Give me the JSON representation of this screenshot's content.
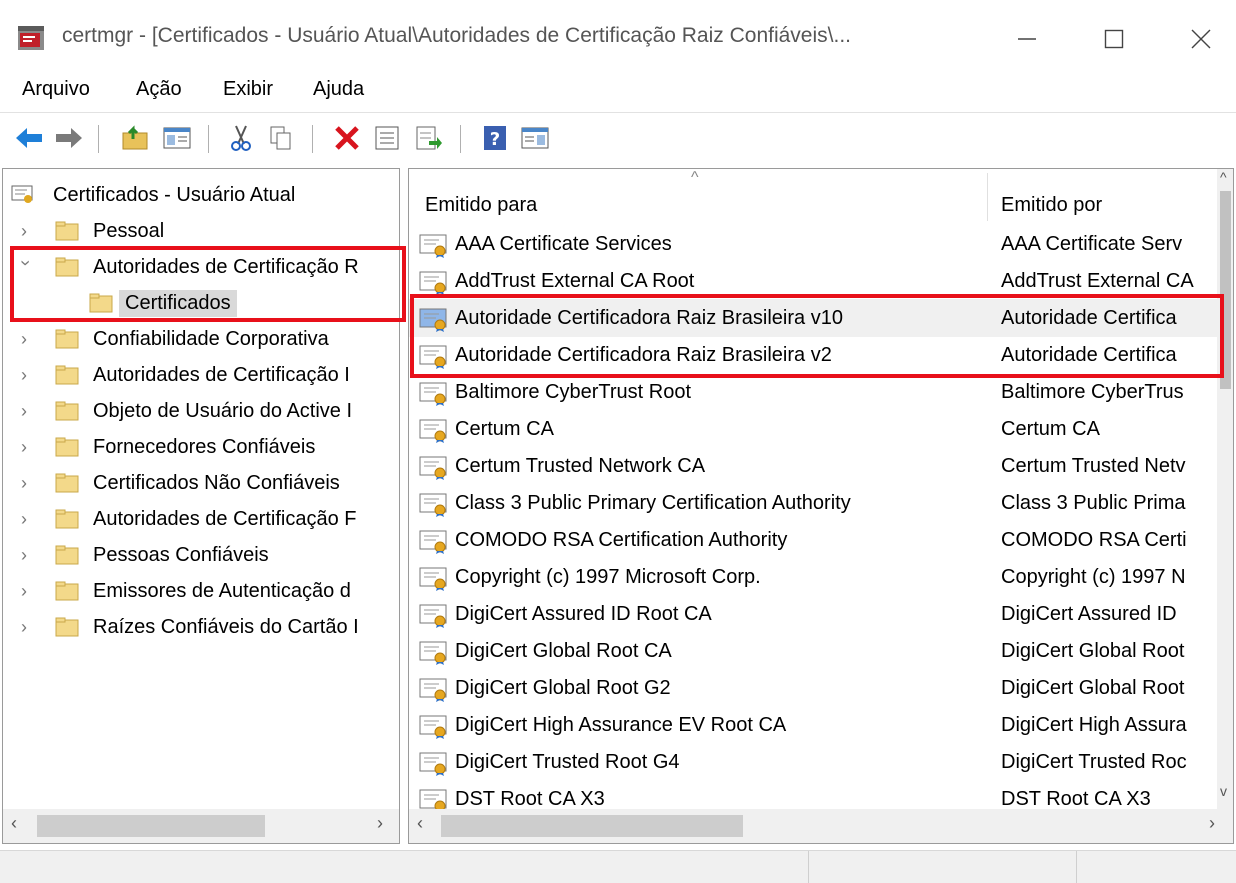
{
  "window": {
    "title": "certmgr - [Certificados - Usuário Atual\\Autoridades de Certificação Raiz Confiáveis\\..."
  },
  "menu": [
    "Arquivo",
    "Ação",
    "Exibir",
    "Ajuda"
  ],
  "toolbar_icons": [
    "back-arrow-icon",
    "forward-arrow-icon",
    "up-folder-icon",
    "show-hide-console-tree-icon",
    "cut-icon",
    "copy-icon",
    "delete-icon",
    "properties-icon",
    "export-list-icon",
    "help-icon",
    "action-pane-icon"
  ],
  "tree": {
    "root": "Certificados - Usuário Atual",
    "items": [
      {
        "label": "Pessoal",
        "expanded": false
      },
      {
        "label": "Autoridades de Certificação R",
        "expanded": true
      },
      {
        "label": "Certificados",
        "child": true,
        "selected": true
      },
      {
        "label": "Confiabilidade Corporativa",
        "expanded": false
      },
      {
        "label": "Autoridades de Certificação I",
        "expanded": false
      },
      {
        "label": "Objeto de Usuário do Active I",
        "expanded": false
      },
      {
        "label": "Fornecedores Confiáveis",
        "expanded": false
      },
      {
        "label": "Certificados Não Confiáveis",
        "expanded": false
      },
      {
        "label": "Autoridades de Certificação F",
        "expanded": false
      },
      {
        "label": "Pessoas Confiáveis",
        "expanded": false
      },
      {
        "label": "Emissores de Autenticação d",
        "expanded": false
      },
      {
        "label": "Raízes Confiáveis do Cartão I",
        "expanded": false
      }
    ]
  },
  "list": {
    "columns": [
      "Emitido para",
      "Emitido por"
    ],
    "rows": [
      {
        "issued_to": "AAA Certificate Services",
        "issued_by": "AAA Certificate Serv"
      },
      {
        "issued_to": "AddTrust External CA Root",
        "issued_by": "AddTrust External CA"
      },
      {
        "issued_to": "Autoridade Certificadora Raiz Brasileira v10",
        "issued_by": "Autoridade Certifica",
        "hover": true
      },
      {
        "issued_to": "Autoridade Certificadora Raiz Brasileira v2",
        "issued_by": "Autoridade Certifica"
      },
      {
        "issued_to": "Baltimore CyberTrust Root",
        "issued_by": "Baltimore CyberTrus"
      },
      {
        "issued_to": "Certum CA",
        "issued_by": "Certum CA"
      },
      {
        "issued_to": "Certum Trusted Network CA",
        "issued_by": "Certum Trusted Netv"
      },
      {
        "issued_to": "Class 3 Public Primary Certification Authority",
        "issued_by": "Class 3 Public Prima"
      },
      {
        "issued_to": "COMODO RSA Certification Authority",
        "issued_by": "COMODO RSA Certi"
      },
      {
        "issued_to": "Copyright (c) 1997 Microsoft Corp.",
        "issued_by": "Copyright (c) 1997 N"
      },
      {
        "issued_to": "DigiCert Assured ID Root CA",
        "issued_by": "DigiCert Assured ID"
      },
      {
        "issued_to": "DigiCert Global Root CA",
        "issued_by": "DigiCert Global Root"
      },
      {
        "issued_to": "DigiCert Global Root G2",
        "issued_by": "DigiCert Global Root"
      },
      {
        "issued_to": "DigiCert High Assurance EV Root CA",
        "issued_by": "DigiCert High Assura"
      },
      {
        "issued_to": "DigiCert Trusted Root G4",
        "issued_by": "DigiCert Trusted Roc"
      },
      {
        "issued_to": "DST Root CA X3",
        "issued_by": "DST Root CA X3"
      }
    ]
  },
  "highlight_color": "#e8101a"
}
